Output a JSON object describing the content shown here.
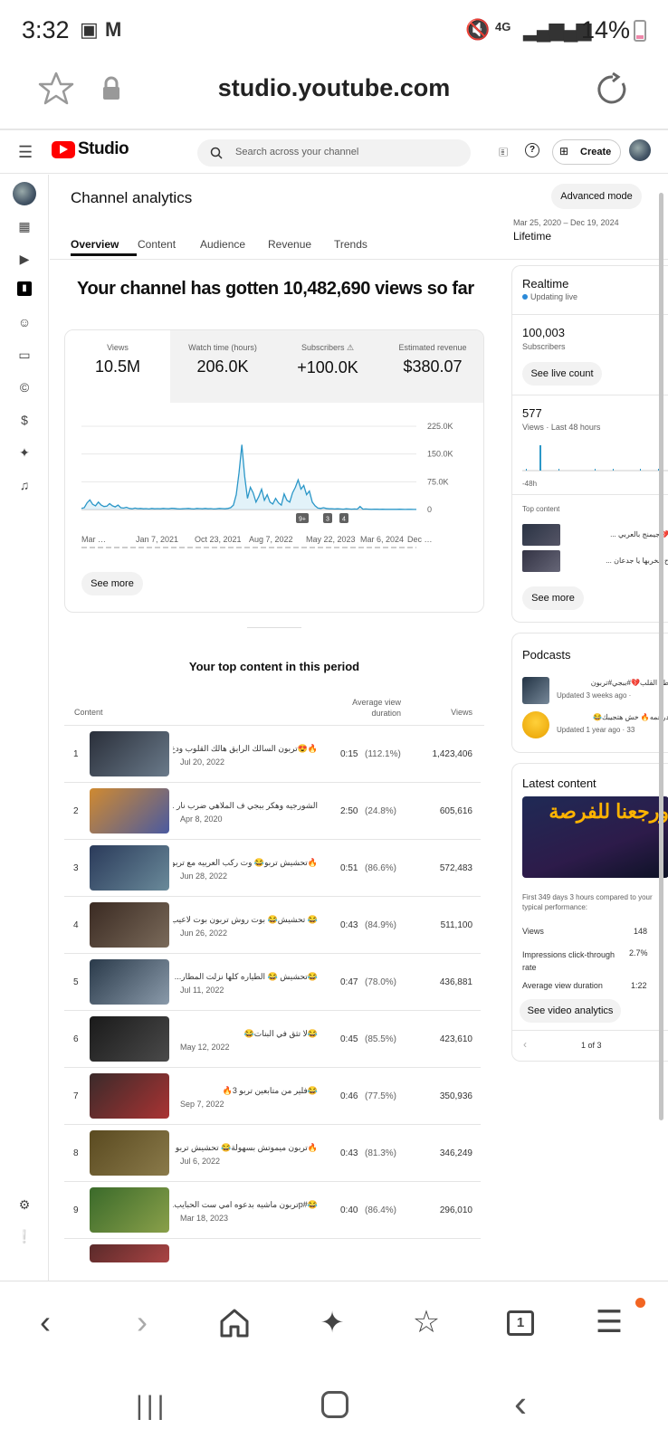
{
  "status_bar": {
    "time": "3:32",
    "signal": "4G",
    "battery": "14%"
  },
  "browser": {
    "url": "studio.youtube.com",
    "tab_count": "1"
  },
  "header": {
    "logo": "Studio",
    "search_placeholder": "Search across your channel",
    "create_label": "Create"
  },
  "page": {
    "title": "Channel analytics",
    "advanced_mode": "Advanced mode",
    "date_range": "Mar 25, 2020 – Dec 19, 2024",
    "period": "Lifetime",
    "tabs": [
      "Overview",
      "Content",
      "Audience",
      "Revenue",
      "Trends"
    ],
    "headline": "Your channel has gotten 10,482,690 views so far"
  },
  "metrics": [
    {
      "label": "Views",
      "value": "10.5M"
    },
    {
      "label": "Watch time (hours)",
      "value": "206.0K"
    },
    {
      "label": "Subscribers",
      "value": "+100.0K"
    },
    {
      "label": "Estimated revenue",
      "value": "$380.07"
    }
  ],
  "chart_data": {
    "type": "line",
    "x_ticks": [
      "Mar …",
      "Jan 7, 2021",
      "Oct 23, 2021",
      "Aug 7, 2022",
      "May 22, 2023",
      "Mar 6, 2024",
      "Dec …"
    ],
    "y_ticks": [
      "225.0K",
      "150.0K",
      "75.0K",
      "0"
    ],
    "ylim": [
      0,
      225000
    ],
    "markers": [
      "9+",
      "3",
      "4"
    ],
    "series": [
      {
        "values": [
          3000,
          5000,
          18000,
          26000,
          14000,
          10000,
          20000,
          12000,
          8000,
          9000,
          16000,
          10000,
          7000,
          12000,
          5000,
          4000,
          6000,
          3000,
          2000,
          4000,
          2500,
          3000,
          2000,
          2500,
          1500,
          3000,
          2000,
          2500,
          2000,
          3000,
          2500,
          2000,
          3500,
          3000,
          2000,
          1500,
          2000,
          2500,
          3000,
          2000,
          1500,
          3000,
          2500,
          2000,
          3000,
          2000,
          2500,
          1500,
          2000,
          3000,
          2500,
          2000,
          3000,
          5000,
          12000,
          40000,
          100000,
          175000,
          90000,
          30000,
          60000,
          45000,
          20000,
          35000,
          55000,
          25000,
          40000,
          20000,
          15000,
          30000,
          18000,
          12000,
          42000,
          25000,
          20000,
          45000,
          60000,
          80000,
          55000,
          65000,
          40000,
          50000,
          20000,
          10000,
          4000,
          3000,
          5000,
          3000,
          2000,
          2000,
          1500,
          2000,
          1500,
          1000,
          2000,
          1500,
          1000,
          1500,
          1000,
          8000,
          1000,
          1500,
          1000,
          500,
          1000,
          800,
          500,
          700,
          500,
          600,
          500,
          400,
          500,
          800,
          400,
          300,
          500,
          400,
          300,
          300
        ]
      }
    ]
  },
  "see_more": "See more",
  "top_content": {
    "heading": "Your top content in this period",
    "columns": [
      "Content",
      "Average view duration",
      "Views"
    ],
    "rows": [
      {
        "rank": "1",
        "title": "🔥😍تربون السالك الرايق هالك القلوب ودع",
        "date": "Jul 20, 2022",
        "duration": "0:15",
        "pct": "(112.1%)",
        "views": "1,423,406"
      },
      {
        "rank": "2",
        "title": "الشورجيه وهكر ببجي ف الملاهي ضرب نار ...",
        "date": "Apr 8, 2020",
        "duration": "2:50",
        "pct": "(24.8%)",
        "views": "605,616"
      },
      {
        "rank": "3",
        "title": "🔥تحشيش تربو😂 وت ركب العربيه مع تربو...",
        "date": "Jun 28, 2022",
        "duration": "0:51",
        "pct": "(86.6%)",
        "views": "572,483"
      },
      {
        "rank": "4",
        "title": "😂 تحشيش😂 بوت روش تربون بوت لاعيب...",
        "date": "Jun 26, 2022",
        "duration": "0:43",
        "pct": "(84.9%)",
        "views": "511,100"
      },
      {
        "rank": "5",
        "title": "😂تحشيش 😂 الطياره كلها نزلت المطار...",
        "date": "Jul 11, 2022",
        "duration": "0:47",
        "pct": "(78.0%)",
        "views": "436,881"
      },
      {
        "rank": "6",
        "title": "😂لا تثق في البنات😂",
        "date": "May 12, 2022",
        "duration": "0:45",
        "pct": "(85.5%)",
        "views": "423,610"
      },
      {
        "rank": "7",
        "title": "😂فلير من متابعين تربو 3🔥",
        "date": "Sep 7, 2022",
        "duration": "0:46",
        "pct": "(77.5%)",
        "views": "350,936"
      },
      {
        "rank": "8",
        "title": "🔥تربون ميموتش بسهولة😂 تحشيش تربو",
        "date": "Jul 6, 2022",
        "duration": "0:43",
        "pct": "(81.3%)",
        "views": "346,249"
      },
      {
        "rank": "9",
        "title": "😂#pتربون ماشيه بدعوه امي ست الحبايب...",
        "date": "Mar 18, 2023",
        "duration": "0:40",
        "pct": "(86.4%)",
        "views": "296,010"
      }
    ]
  },
  "realtime": {
    "title": "Realtime",
    "status": "Updating live",
    "subscribers_value": "100,003",
    "subscribers_label": "Subscribers",
    "see_live": "See live count",
    "views_value": "577",
    "views_label": "Views · Last 48 hours",
    "axis_label": "-48h",
    "top_content_label": "Top content",
    "top_items": [
      "💔جيمنج بالعربي ...",
      "ح هخربها يا جدعان ..."
    ],
    "see_more": "See more"
  },
  "podcasts": {
    "title": "Podcasts",
    "items": [
      {
        "title": "طع القلب💔#ببجي#تربون",
        "meta": "Updated 3 weeks ago ·"
      },
      {
        "title": "درعمه🔥 خش هتجيبك😂",
        "meta": "Updated 1 year ago · 33"
      }
    ]
  },
  "latest": {
    "title": "Latest content",
    "thumb_text": "ورجعنا للفرصة",
    "caption": "First 349 days 3 hours compared to your typical performance:",
    "stats": [
      {
        "label": "Views",
        "value": "148"
      },
      {
        "label": "Impressions click-through rate",
        "value": "2.7%"
      },
      {
        "label": "Average view duration",
        "value": "1:22"
      }
    ],
    "button": "See video analytics",
    "pager": "1 of 3"
  }
}
